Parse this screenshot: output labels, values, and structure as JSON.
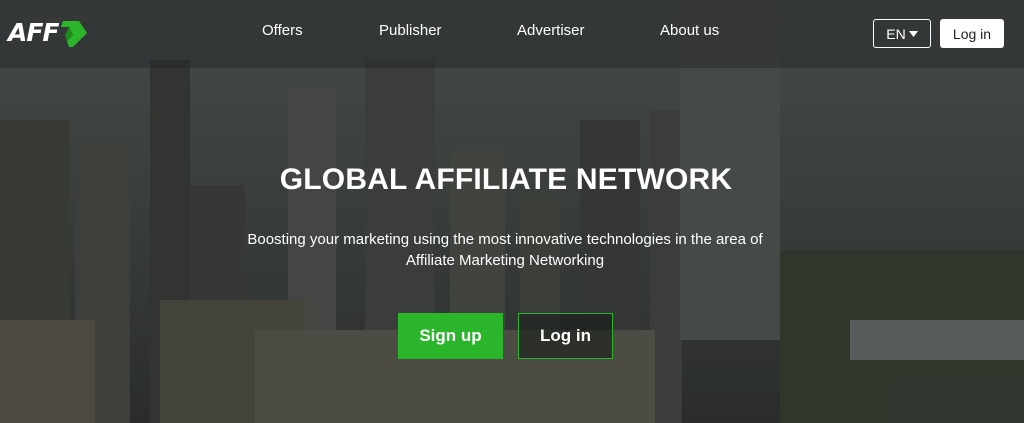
{
  "brand": {
    "logo_text": "AFF",
    "accent": "#2ab52a"
  },
  "nav": {
    "items": [
      {
        "label": "Offers"
      },
      {
        "label": "Publisher"
      },
      {
        "label": "Advertiser"
      },
      {
        "label": "About us"
      }
    ],
    "language": "EN",
    "login_label": "Log in"
  },
  "hero": {
    "title": "GLOBAL AFFILIATE NETWORK",
    "subtitle": "Boosting your marketing using the most innovative technologies in the area of Affiliate Marketing Networking",
    "signup_label": "Sign up",
    "login_label": "Log in"
  },
  "icons": {
    "language_caret": "caret-down-icon",
    "logo_arrow": "logo-arrow-icon"
  }
}
